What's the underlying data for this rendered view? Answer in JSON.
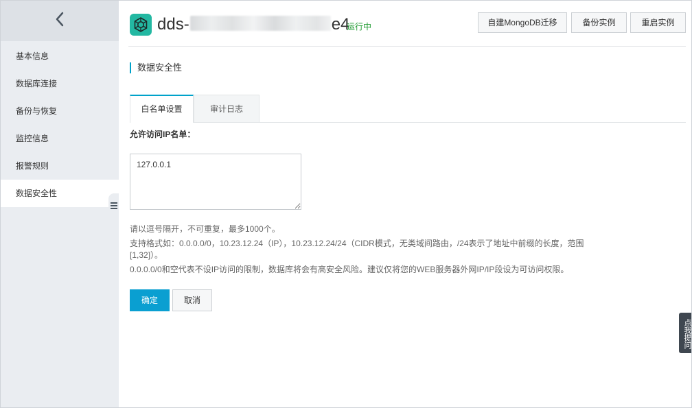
{
  "sidebar": {
    "back_icon": "chevron-left-icon",
    "items": [
      {
        "label": "基本信息"
      },
      {
        "label": "数据库连接"
      },
      {
        "label": "备份与恢复"
      },
      {
        "label": "监控信息"
      },
      {
        "label": "报警规则"
      },
      {
        "label": "数据安全性",
        "active": true
      }
    ],
    "collapse_icon": "menu-collapse-icon"
  },
  "header": {
    "logo_icon": "mongodb-logo-icon",
    "instance_prefix": "dds-",
    "instance_suffix": "e4",
    "status": "运行中",
    "buttons": [
      {
        "label": "自建MongoDB迁移"
      },
      {
        "label": "备份实例"
      },
      {
        "label": "重启实例"
      }
    ]
  },
  "section": {
    "title": "数据安全性"
  },
  "tabs": [
    {
      "label": "白名单设置",
      "active": true
    },
    {
      "label": "审计日志",
      "active": false
    }
  ],
  "form": {
    "field_label": "允许访问IP名单：",
    "ip_value": "127.0.0.1",
    "help_lines": [
      "请以逗号隔开，不可重复，最多1000个。",
      "支持格式如：0.0.0.0/0，10.23.12.24（IP），10.23.12.24/24（CIDR模式，无类域间路由，/24表示了地址中前缀的长度，范围[1,32]）。",
      "0.0.0.0/0和空代表不设IP访问的限制，数据库将会有高安全风险。建议仅将您的WEB服务器外网IP/IP段设为可访问权限。"
    ],
    "confirm_label": "确定",
    "cancel_label": "取消"
  },
  "float_tab": {
    "label": "点我提问"
  },
  "colors": {
    "accent": "#00a2ca",
    "primary_button": "#0a9fd1",
    "status_green": "#1e9a30",
    "logo_teal": "#23b8a2",
    "sidebar_bg": "#eaedf1"
  }
}
